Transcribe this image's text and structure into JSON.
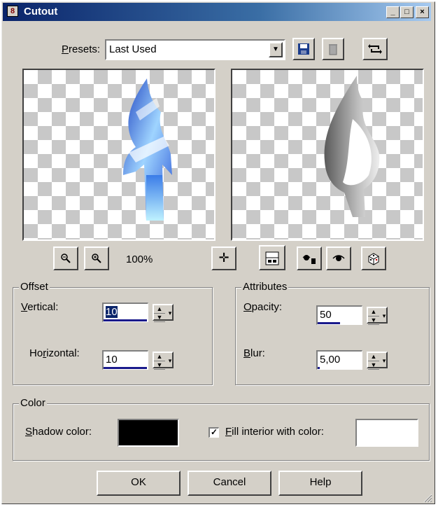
{
  "window": {
    "title": "Cutout",
    "app_icon_glyph": "8",
    "controls": {
      "minimize": "_",
      "maximize": "□",
      "close": "×"
    }
  },
  "presets": {
    "label": "Presets:",
    "value": "Last Used",
    "icons": [
      "save-preset-icon",
      "delete-preset-icon",
      "reset-icon"
    ]
  },
  "preview": {
    "zoom": "100%",
    "icons": [
      "zoom-out-icon",
      "zoom-in-icon",
      "move-icon",
      "proof-toggle-icon",
      "auto-proof-icon",
      "reset-defaults-icon",
      "randomize-icon"
    ]
  },
  "offset": {
    "legend": "Offset",
    "vertical_label": "Vertical:",
    "vertical_value": "10",
    "horizontal_label": "Horizontal:",
    "horizontal_value": "10"
  },
  "attributes": {
    "legend": "Attributes",
    "opacity_label": "Opacity:",
    "opacity_value": "50",
    "blur_label": "Blur:",
    "blur_value": "5,00"
  },
  "color": {
    "legend": "Color",
    "shadow_label": "Shadow color:",
    "shadow_color": "#000000",
    "fill_label": "Fill interior with color:",
    "fill_checked": true,
    "fill_color": "#ffffff"
  },
  "buttons": {
    "ok": "OK",
    "cancel": "Cancel",
    "help": "Help"
  }
}
